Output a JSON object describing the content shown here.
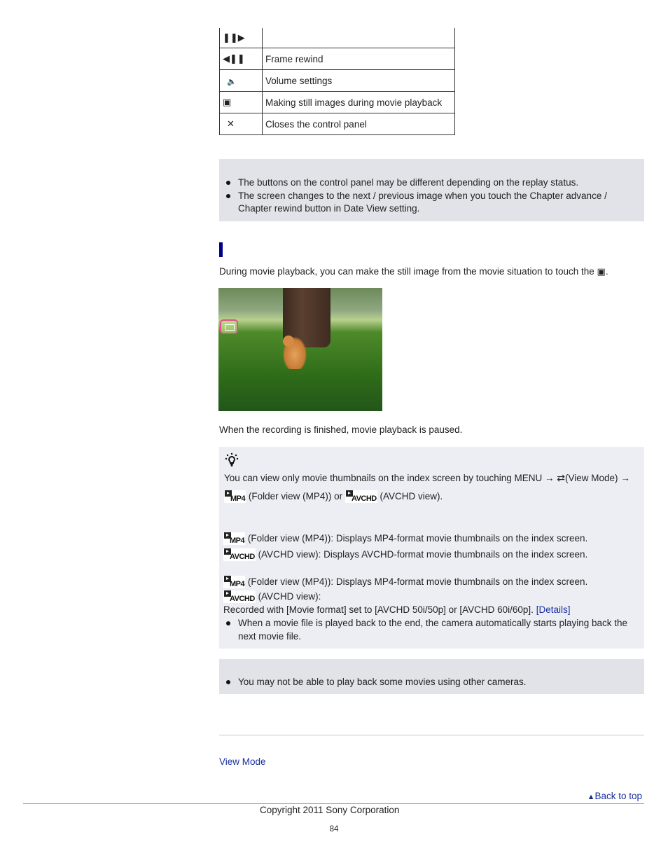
{
  "control_table": {
    "rows": [
      {
        "icon": "frame-advance-icon",
        "glyph": "❚❚▶",
        "label": ""
      },
      {
        "icon": "frame-rewind-icon",
        "glyph": "◀❚❚",
        "label": "Frame rewind"
      },
      {
        "icon": "volume-icon",
        "glyph": "🔈",
        "label": "Volume settings"
      },
      {
        "icon": "still-capture-icon",
        "glyph": "▣",
        "label": "Making still images during movie playback"
      },
      {
        "icon": "close-icon",
        "glyph": "✕",
        "label": "Closes the control panel"
      }
    ]
  },
  "note1": {
    "items": [
      "The buttons on the control panel may be different depending on the replay status.",
      "The screen changes to the next / previous image when you touch the Chapter advance / Chapter rewind button in Date View setting."
    ]
  },
  "section": {
    "intro": "During movie playback, you can make the still image from the movie situation to touch the",
    "intro_end": ".",
    "after_image": "When the recording is finished, movie playback is paused."
  },
  "hint": {
    "line1_a": "You can view only movie thumbnails on the index screen by touching MENU",
    "arrow": "→",
    "line1_b": "(View Mode)",
    "line1_c": "(Folder view (MP4)) or",
    "line1_d": "(AVCHD view).",
    "mp4_label": "MP4",
    "avchd_label": "AVCHD",
    "block1_mp4": "(Folder view (MP4)): Displays MP4-format movie thumbnails on the index screen.",
    "block1_avchd": "(AVCHD view): Displays AVCHD-format movie thumbnails on the index screen.",
    "block2_mp4": "(Folder view (MP4)): Displays MP4-format movie thumbnails on the index screen.",
    "block2_avchd": "(AVCHD view):",
    "recorded": "Recorded with [Movie format] set to [AVCHD 50i/50p] or [AVCHD 60i/60p].",
    "details_link": "[Details]",
    "bullet": "When a movie file is played back to the end, the camera automatically starts playing back the next movie file."
  },
  "note2": {
    "items": [
      "You may not be able to play back some movies using other cameras."
    ]
  },
  "related_link": "View Mode",
  "back_to_top": "Back to top",
  "copyright": "Copyright 2011 Sony Corporation",
  "page_number": "84",
  "colors": {
    "link": "#1a2fa0",
    "heading_bar": "#00008b",
    "note_bg": "#e1e3e8",
    "hint_bg": "#eceef3"
  }
}
